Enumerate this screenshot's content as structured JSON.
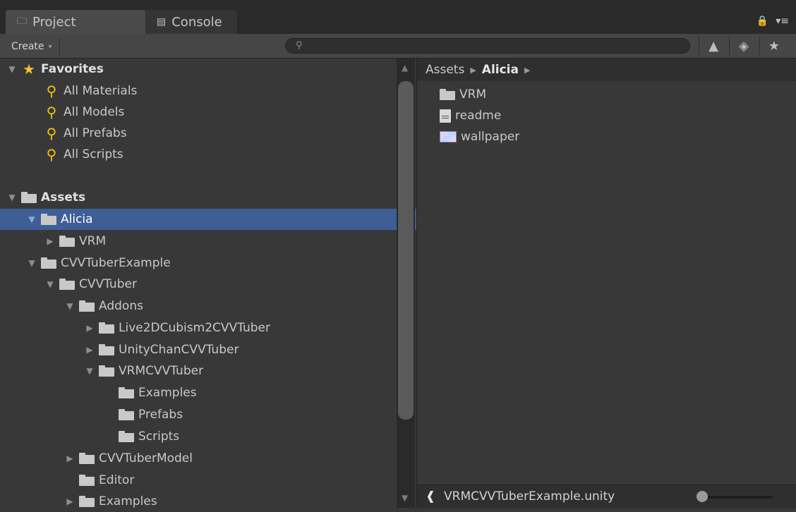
{
  "tabs": [
    {
      "label": "Project",
      "icon": "folder-icon"
    },
    {
      "label": "Console",
      "icon": "console-icon"
    }
  ],
  "toolbar": {
    "create_label": "Create",
    "search_placeholder": ""
  },
  "tree": {
    "favorites": {
      "label": "Favorites",
      "items": [
        "All Materials",
        "All Models",
        "All Prefabs",
        "All Scripts"
      ]
    },
    "assets_label": "Assets",
    "nodes": [
      {
        "label": "Alicia",
        "selected": true
      },
      {
        "label": "VRM"
      },
      {
        "label": "CVVTuberExample"
      },
      {
        "label": "CVVTuber"
      },
      {
        "label": "Addons"
      },
      {
        "label": "Live2DCubism2CVVTuber"
      },
      {
        "label": "UnityChanCVVTuber"
      },
      {
        "label": "VRMCVVTuber"
      },
      {
        "label": "Examples"
      },
      {
        "label": "Prefabs"
      },
      {
        "label": "Scripts"
      },
      {
        "label": "CVVTuberModel"
      },
      {
        "label": "Editor"
      },
      {
        "label": "Examples"
      }
    ]
  },
  "breadcrumb": {
    "root": "Assets",
    "current": "Alicia"
  },
  "files": [
    {
      "label": "VRM",
      "icon": "folder-icon"
    },
    {
      "label": "readme",
      "icon": "document-icon"
    },
    {
      "label": "wallpaper",
      "icon": "image-icon"
    }
  ],
  "status": {
    "label": "VRMCVVTuberExample.unity",
    "zoom_fraction": 0.0
  }
}
